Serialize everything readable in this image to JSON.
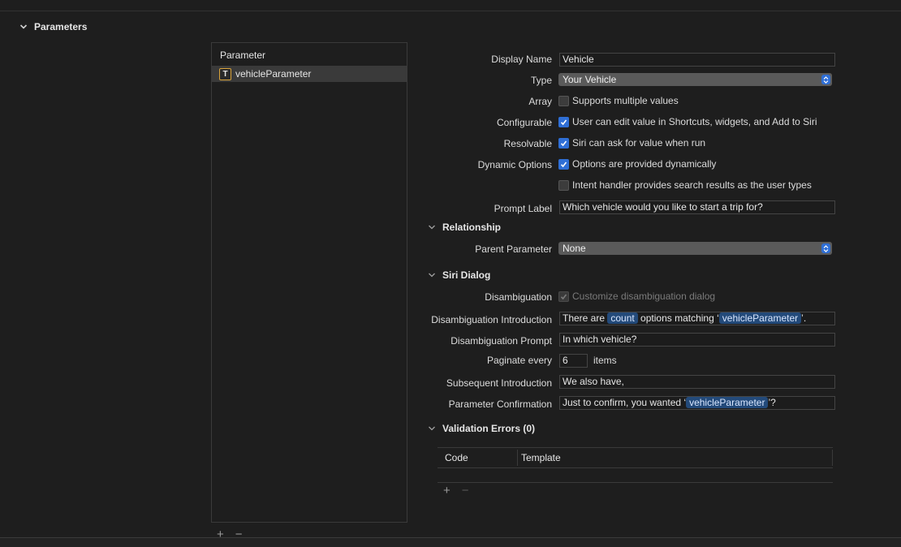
{
  "section": {
    "title": "Parameters"
  },
  "parameter_list": {
    "header": "Parameter",
    "items": [
      {
        "icon": "text-type-icon",
        "glyph": "T",
        "name": "vehicleParameter"
      }
    ],
    "add_label": "+",
    "remove_label": "−"
  },
  "form": {
    "display_name": {
      "label": "Display Name",
      "value": "Vehicle"
    },
    "type": {
      "label": "Type",
      "value": "Your Vehicle"
    },
    "array": {
      "label": "Array",
      "option": "Supports multiple values",
      "checked": false
    },
    "configurable": {
      "label": "Configurable",
      "option": "User can edit value in Shortcuts, widgets, and Add to Siri",
      "checked": true
    },
    "resolvable": {
      "label": "Resolvable",
      "option": "Siri can ask for value when run",
      "checked": true
    },
    "dynamic_options": {
      "label": "Dynamic Options",
      "option": "Options are provided dynamically",
      "checked": true,
      "option2": "Intent handler provides search results as the user types",
      "checked2": false
    },
    "prompt_label": {
      "label": "Prompt Label",
      "value": "Which vehicle would you like to start a trip for?"
    }
  },
  "relationship": {
    "title": "Relationship",
    "parent_parameter": {
      "label": "Parent Parameter",
      "value": "None"
    }
  },
  "siri_dialog": {
    "title": "Siri Dialog",
    "disambiguation": {
      "label": "Disambiguation",
      "option": "Customize disambiguation dialog",
      "checked": true,
      "disabled": true
    },
    "introduction": {
      "label": "Disambiguation Introduction",
      "prefix": "There are ",
      "token1": "count",
      "middle": " options matching ‘",
      "token2": "vehicleParameter",
      "suffix": "’."
    },
    "prompt": {
      "label": "Disambiguation Prompt",
      "value": "In which vehicle?"
    },
    "paginate": {
      "label": "Paginate every",
      "value": "6",
      "unit": "items"
    },
    "subsequent": {
      "label": "Subsequent Introduction",
      "value": "We also have,"
    },
    "confirmation": {
      "label": "Parameter Confirmation",
      "prefix": "Just to confirm, you wanted ‘",
      "token": "vehicleParameter",
      "suffix": "’?"
    }
  },
  "validation": {
    "title": "Validation Errors (0)",
    "columns": [
      "Code",
      "Template"
    ],
    "add_label": "+",
    "remove_label": "−"
  },
  "colors": {
    "accent": "#2f6fd6",
    "token_bg": "#234a7a",
    "background": "#1e1e1e"
  }
}
